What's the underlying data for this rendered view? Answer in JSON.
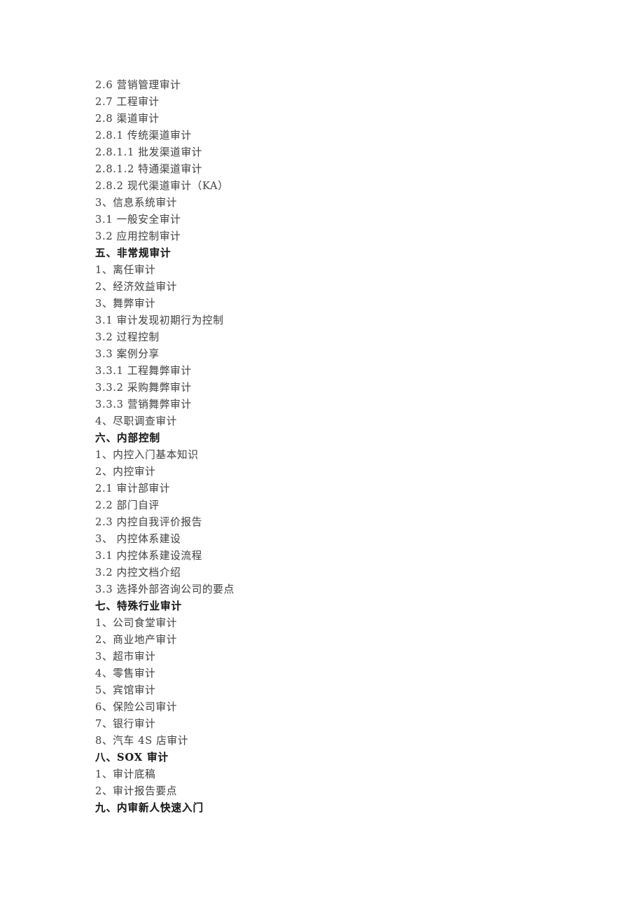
{
  "document": {
    "type": "scanned-table-of-contents",
    "background_color": "#ffffff",
    "body_text_color": "#4a4a4a",
    "heading_text_color": "#1f1f1f",
    "lines": [
      {
        "text": "2.6 营销管理审计",
        "heading": false
      },
      {
        "text": "2.7 工程审计",
        "heading": false
      },
      {
        "text": "2.8 渠道审计",
        "heading": false
      },
      {
        "text": "2.8.1 传统渠道审计",
        "heading": false
      },
      {
        "text": "2.8.1.1 批发渠道审计",
        "heading": false
      },
      {
        "text": "2.8.1.2 特通渠道审计",
        "heading": false
      },
      {
        "text": "2.8.2 现代渠道审计（KA）",
        "heading": false
      },
      {
        "text": "3、信息系统审计",
        "heading": false
      },
      {
        "text": "3.1 一般安全审计",
        "heading": false
      },
      {
        "text": "3.2 应用控制审计",
        "heading": false
      },
      {
        "text": "五、非常规审计",
        "heading": true
      },
      {
        "text": "1、离任审计",
        "heading": false
      },
      {
        "text": "2、经济效益审计",
        "heading": false
      },
      {
        "text": "3、舞弊审计",
        "heading": false
      },
      {
        "text": "3.1 审计发现初期行为控制",
        "heading": false
      },
      {
        "text": "3.2 过程控制",
        "heading": false
      },
      {
        "text": "3.3 案例分享",
        "heading": false
      },
      {
        "text": "3.3.1 工程舞弊审计",
        "heading": false
      },
      {
        "text": "3.3.2 采购舞弊审计",
        "heading": false
      },
      {
        "text": "3.3.3 营销舞弊审计",
        "heading": false
      },
      {
        "text": "4、尽职调查审计",
        "heading": false
      },
      {
        "text": "六、内部控制",
        "heading": true
      },
      {
        "text": "1、内控入门基本知识",
        "heading": false
      },
      {
        "text": "2、内控审计",
        "heading": false
      },
      {
        "text": "2.1 审计部审计",
        "heading": false
      },
      {
        "text": "2.2 部门自评",
        "heading": false
      },
      {
        "text": "2.3 内控自我评价报告",
        "heading": false
      },
      {
        "text": "3、 内控体系建设",
        "heading": false
      },
      {
        "text": "3.1 内控体系建设流程",
        "heading": false
      },
      {
        "text": "3.2 内控文档介绍",
        "heading": false
      },
      {
        "text": "3.3 选择外部咨询公司的要点",
        "heading": false
      },
      {
        "text": "七、特殊行业审计",
        "heading": true
      },
      {
        "text": "1、公司食堂审计",
        "heading": false
      },
      {
        "text": "2、商业地产审计",
        "heading": false
      },
      {
        "text": "3、超市审计",
        "heading": false
      },
      {
        "text": "4、零售审计",
        "heading": false
      },
      {
        "text": "5、宾馆审计",
        "heading": false
      },
      {
        "text": "6、保险公司审计",
        "heading": false
      },
      {
        "text": "7、银行审计",
        "heading": false
      },
      {
        "text": "8、汽车 4S 店审计",
        "heading": false
      },
      {
        "text": "八、SOX 审计",
        "heading": true
      },
      {
        "text": "1、审计底稿",
        "heading": false
      },
      {
        "text": "2、审计报告要点",
        "heading": false
      },
      {
        "text": "九、内审新人快速入门",
        "heading": true
      }
    ]
  }
}
